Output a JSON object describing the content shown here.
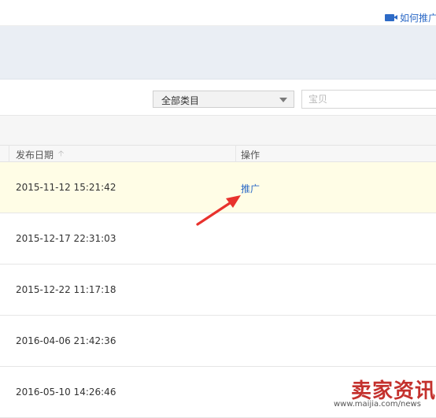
{
  "header": {
    "help_link_label": "如何推广",
    "help_icon": "video-icon",
    "link_color": "#2d6ac6"
  },
  "filters": {
    "category_selected": "全部类目",
    "search_placeholder": "宝贝"
  },
  "table": {
    "columns": {
      "publish_date": "发布日期",
      "operation": "操作"
    },
    "sort_icon": "up-arrow-icon",
    "rows": [
      {
        "publish_date": "2015-11-12 15:21:42",
        "action": "推广",
        "highlighted": true
      },
      {
        "publish_date": "2015-12-17 22:31:03",
        "action": ""
      },
      {
        "publish_date": "2015-12-22 11:17:18",
        "action": ""
      },
      {
        "publish_date": "2016-04-06 21:42:36",
        "action": ""
      },
      {
        "publish_date": "2016-05-10 14:26:46",
        "action": ""
      }
    ],
    "highlight_color": "#fffde6"
  },
  "annotation": {
    "arrow_color": "#e8322d"
  },
  "watermark": {
    "title": "卖家资讯",
    "url": "www.maijia.com/news",
    "color": "#c4312d"
  }
}
